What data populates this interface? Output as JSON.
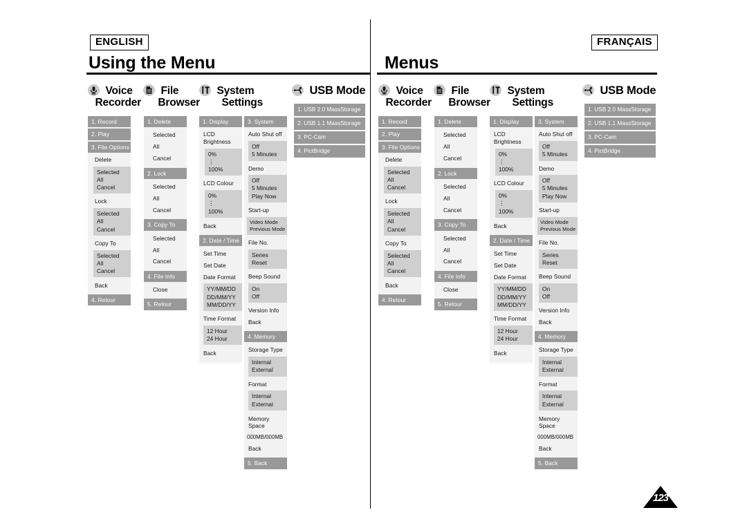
{
  "left": {
    "language": "ENGLISH",
    "title": "Using the Menu"
  },
  "right": {
    "language": "FRANÇAIS",
    "title": "Menus"
  },
  "page_number": "123",
  "categories": {
    "voice_recorder": {
      "line1": "Voice",
      "line2": "Recorder",
      "icon": "microphone-icon"
    },
    "file_browser": {
      "line1": "File",
      "line2": "Browser",
      "icon": "document-icon"
    },
    "system_settings": {
      "line1": "System",
      "line2": "Settings",
      "icon": "system-tools-icon"
    },
    "usb_mode": {
      "line1": "USB Mode",
      "icon": "usb-icon"
    }
  },
  "voice_recorder_menu": {
    "record": "1. Record",
    "play": "2. Play",
    "file_options": "3. File Options",
    "delete": "Delete",
    "delete_options": [
      "Selected",
      "All",
      "Cancel"
    ],
    "lock": "Lock",
    "lock_options": [
      "Selected",
      "All",
      "Cancel"
    ],
    "copy_to": "Copy To",
    "copy_to_options": [
      "Selected",
      "All",
      "Cancel"
    ],
    "back": "Back",
    "retour": "4. Retour"
  },
  "file_browser_menu": {
    "delete": "1. Delete",
    "delete_options": [
      "Selected",
      "All",
      "Cancel"
    ],
    "lock": "2. Lock",
    "lock_options": [
      "Selected",
      "All",
      "Cancel"
    ],
    "copy_to": "3. Copy To",
    "copy_to_options": [
      "Selected",
      "All",
      "Cancel"
    ],
    "file_info": "4. File Info",
    "close": "Close",
    "retour": "5. Retour"
  },
  "system_display_menu": {
    "display": "1. Display",
    "lcd_brightness": "LCD Brightness",
    "lcd_brightness_range": [
      "0%",
      "⋮",
      "100%"
    ],
    "lcd_colour": "LCD Colour",
    "lcd_colour_range": [
      "0%",
      "⋮",
      "100%"
    ],
    "back1": "Back",
    "date_time": "2. Date / Time",
    "set_time": "Set Time",
    "set_date": "Set Date",
    "date_format": "Date Format",
    "date_format_options": [
      "YY/MM/DD",
      "DD/MM/YY",
      "MM/DD/YY"
    ],
    "time_format": "Time Format",
    "time_format_options": [
      "12 Hour",
      "24 Hour"
    ],
    "back2": "Back"
  },
  "system_system_menu": {
    "system": "3. System",
    "auto_shut_off": "Auto Shut off",
    "auto_shut_off_options": [
      "Off",
      "5 Minutes"
    ],
    "demo": "Demo",
    "demo_options": [
      "Off",
      "5 Minutes",
      "Play Now"
    ],
    "start_up": "Start-up",
    "start_up_options": [
      "Video Mode",
      "Previous Mode"
    ],
    "file_no": "File No.",
    "file_no_options": [
      "Series",
      "Reset"
    ],
    "beep_sound": "Beep Sound",
    "beep_sound_options": [
      "On",
      "Off"
    ],
    "version_info": "Version Info",
    "back1": "Back",
    "memory": "4. Memory",
    "storage_type": "Storage Type",
    "storage_type_options": [
      "Internal",
      "External"
    ],
    "format": "Format",
    "format_options": [
      "Internal",
      "External"
    ],
    "memory_space": "Memory Space",
    "memory_space_value": "000MB/000MB",
    "back2": "Back",
    "back_last": "5. Back"
  },
  "usb_mode_menu": {
    "items": [
      "1. USB 2.0 MassStorage",
      "2. USB 1.1 MassStorage",
      "3. PC-Cam",
      "4. PictBridge"
    ]
  },
  "colors": {
    "bar": "#999999",
    "group": "#cfcfcf",
    "column": "#f2f2f2",
    "icon_circle": "#c9c9c9"
  }
}
